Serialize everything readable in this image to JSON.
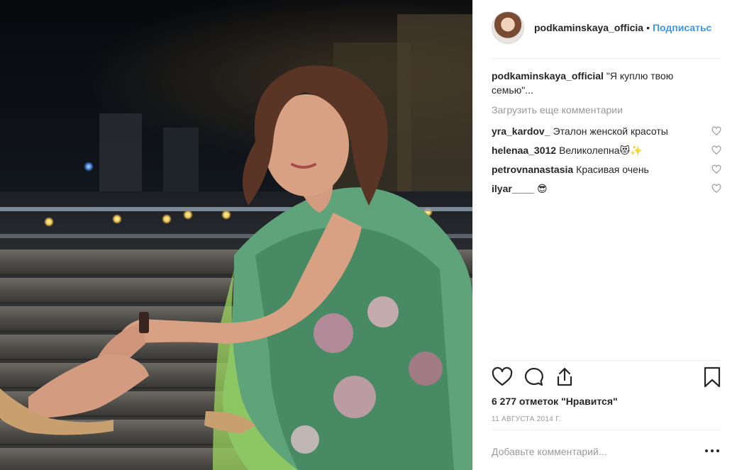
{
  "post": {
    "username": "podkaminskaya_officia",
    "dot": "•",
    "follow_label": "Подписатьс",
    "caption_user": "podkaminskaya_official",
    "caption_text": "\"Я куплю твою семью\"...",
    "load_more": "Загрузить еще комментарии",
    "likes": "6 277 отметок \"Нравится\"",
    "date": "11 АВГУСТА 2014 Г.",
    "comment_placeholder": "Добавьте комментарий..."
  },
  "comments": [
    {
      "user": "yra_kardov_",
      "text": "Эталон женской красоты"
    },
    {
      "user": "helenaa_3012",
      "text": "Великолепна😻✨"
    },
    {
      "user": "petrovnanastasia",
      "text": "Красивая очень"
    },
    {
      "user": "ilyar____",
      "text": "😎"
    }
  ],
  "icons": {
    "like": "heart-icon",
    "comment": "comment-bubble-icon",
    "share": "share-icon",
    "save": "bookmark-icon",
    "options": "more-options-icon",
    "comment_like": "heart-outline-icon"
  },
  "colors": {
    "link": "#3897f0",
    "text": "#262626",
    "muted": "#999999",
    "divider": "#efefef"
  }
}
